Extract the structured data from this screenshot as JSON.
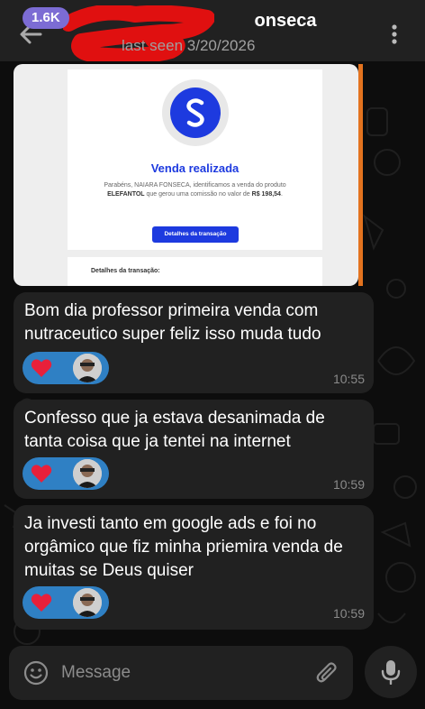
{
  "header": {
    "unread_badge": "1.6K",
    "contact_name": "onseca",
    "last_seen": "last seen 3/20/2026",
    "icons": [
      "back-arrow-icon",
      "more-vertical-icon"
    ]
  },
  "image_message": {
    "heading": "Venda realizada",
    "body_prefix": "Parabéns, NAIARA FONSECA, identificamos a venda do produto ",
    "product": "ELEFANTOL",
    "body_middle": " que gerou uma comissão no valor de ",
    "amount": "R$ 198,54",
    "body_suffix": ".",
    "button_label": "Detalhes da transação",
    "details_label": "Detalhes da transação:"
  },
  "messages": [
    {
      "text": "Bom dia professor primeira venda com nutraceutico super feliz isso muda tudo",
      "time": "10:55",
      "reaction": "heart"
    },
    {
      "text": "Confesso que ja estava desanimada de tanta coisa que ja tentei na internet",
      "time": "10:59",
      "reaction": "heart"
    },
    {
      "text": "Ja investi tanto em google ads e foi no orgâmico que fiz minha priemira venda de muitas se Deus quiser",
      "time": "10:59",
      "reaction": "heart"
    }
  ],
  "composer": {
    "placeholder": "Message",
    "icons": [
      "emoji-icon",
      "paperclip-icon",
      "microphone-icon"
    ]
  },
  "colors": {
    "background": "#0d0d0d",
    "bubble": "#212121",
    "badge": "#7c6cd4",
    "reaction": "#2f80c4",
    "brand_blue": "#1d3adf"
  }
}
